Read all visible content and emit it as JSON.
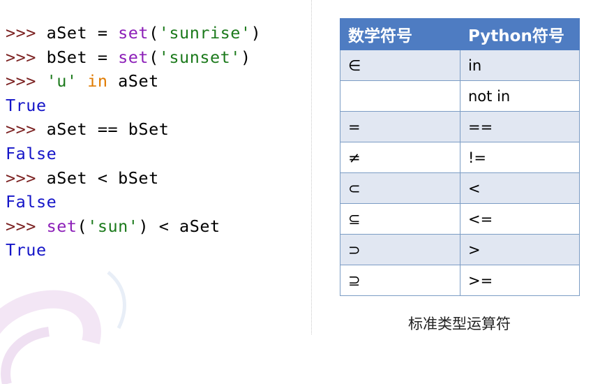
{
  "code_lines": [
    [
      {
        "t": ">>> ",
        "c": "prompt"
      },
      {
        "t": "aSet = ",
        "c": "plain"
      },
      {
        "t": "set",
        "c": "kw-builtin"
      },
      {
        "t": "(",
        "c": "plain"
      },
      {
        "t": "'sunrise'",
        "c": "str"
      },
      {
        "t": ")",
        "c": "plain"
      }
    ],
    [
      {
        "t": ">>> ",
        "c": "prompt"
      },
      {
        "t": "bSet = ",
        "c": "plain"
      },
      {
        "t": "set",
        "c": "kw-builtin"
      },
      {
        "t": "(",
        "c": "plain"
      },
      {
        "t": "'sunset'",
        "c": "str"
      },
      {
        "t": ")",
        "c": "plain"
      }
    ],
    [
      {
        "t": ">>> ",
        "c": "prompt"
      },
      {
        "t": "'u'",
        "c": "str"
      },
      {
        "t": " ",
        "c": "plain"
      },
      {
        "t": "in",
        "c": "kw"
      },
      {
        "t": " aSet",
        "c": "plain"
      }
    ],
    [
      {
        "t": "True",
        "c": "out"
      }
    ],
    [
      {
        "t": ">>> ",
        "c": "prompt"
      },
      {
        "t": "aSet == bSet",
        "c": "plain"
      }
    ],
    [
      {
        "t": "False",
        "c": "out"
      }
    ],
    [
      {
        "t": ">>> ",
        "c": "prompt"
      },
      {
        "t": "aSet < bSet",
        "c": "plain"
      }
    ],
    [
      {
        "t": "False",
        "c": "out"
      }
    ],
    [
      {
        "t": ">>> ",
        "c": "prompt"
      },
      {
        "t": "set",
        "c": "kw-builtin"
      },
      {
        "t": "(",
        "c": "plain"
      },
      {
        "t": "'sun'",
        "c": "str"
      },
      {
        "t": ") < aSet",
        "c": "plain"
      }
    ],
    [
      {
        "t": "True",
        "c": "out"
      }
    ]
  ],
  "table": {
    "headers": [
      "数学符号",
      "Python符号"
    ],
    "rows": [
      [
        "∈",
        "in"
      ],
      [
        "",
        "not in"
      ],
      [
        "=",
        "=="
      ],
      [
        "≠",
        "!="
      ],
      [
        "⊂",
        "<"
      ],
      [
        "⊆",
        "<="
      ],
      [
        "⊃",
        ">"
      ],
      [
        "⊇",
        ">="
      ]
    ]
  },
  "caption": "标准类型运算符",
  "colors": {
    "header_bg": "#4e7cc2",
    "row_alt_bg": "#e1e7f2",
    "prompt": "#7a1f1f",
    "builtin": "#8c1fb8",
    "keyword": "#e07b00",
    "string": "#1c7a1c",
    "output": "#1515c8"
  }
}
